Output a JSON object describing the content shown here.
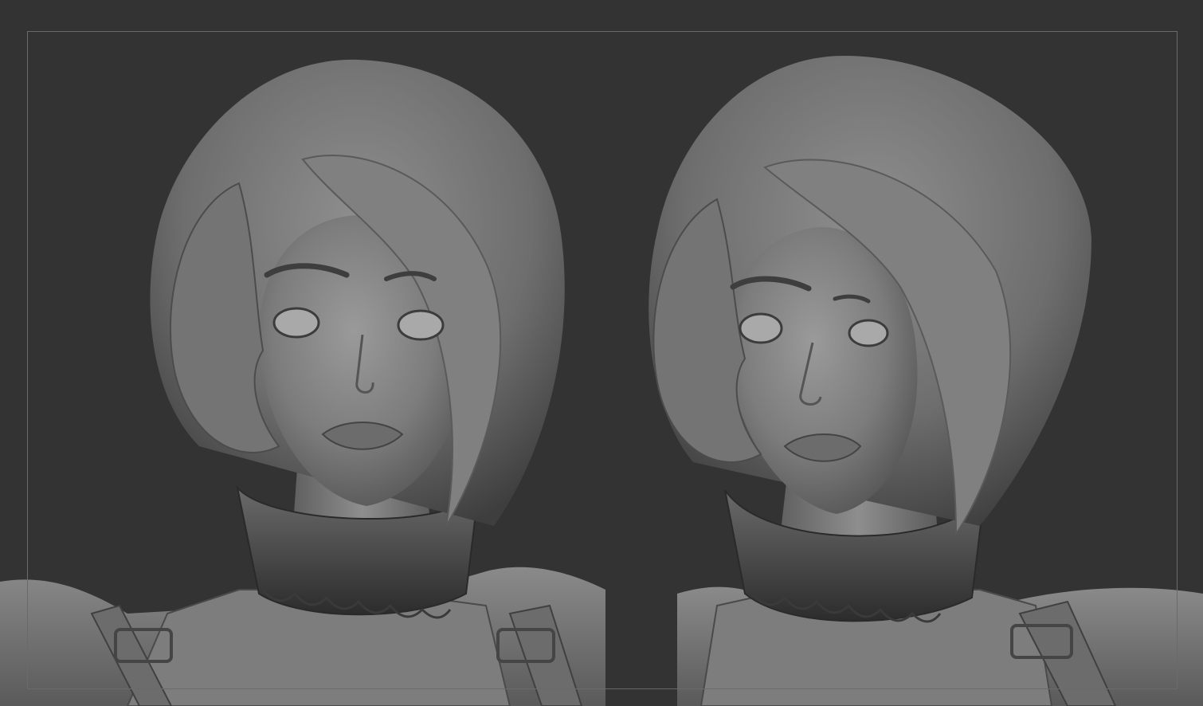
{
  "viewport": {
    "background_color": "#333333",
    "frame_color": "#6a6a6a",
    "clay_color": "#7a7a7a"
  },
  "views": [
    {
      "id": "front",
      "label": ""
    },
    {
      "id": "three-quarter",
      "label": ""
    }
  ]
}
